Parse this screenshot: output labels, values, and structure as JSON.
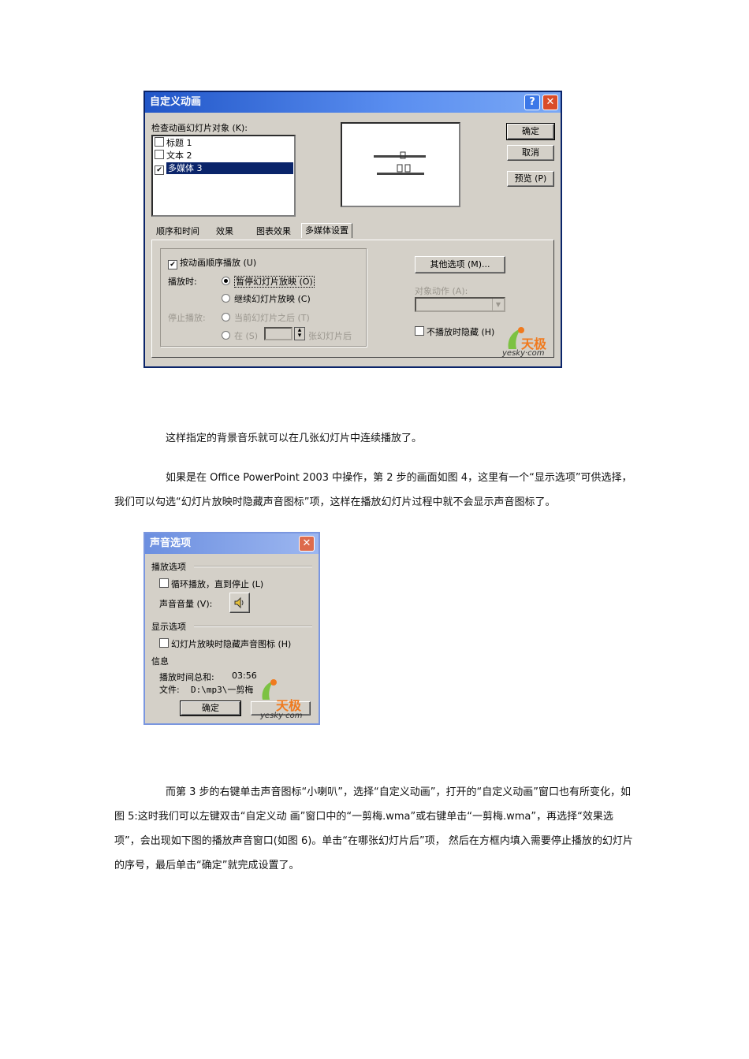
{
  "dialog1": {
    "title": "自定义动画",
    "help_button": "?",
    "close_button": "✕",
    "check_label": "检查动画幻灯片对象 (K):",
    "list_items": [
      {
        "label": "标题 1",
        "checked": false
      },
      {
        "label": "文本 2",
        "checked": false
      },
      {
        "label": "多媒体 3",
        "checked": true
      }
    ],
    "buttons": {
      "ok": "确定",
      "cancel": "取消",
      "preview": "预览 (P)"
    },
    "tabs": [
      "顺序和时间",
      "效果",
      "图表效果",
      "多媒体设置"
    ],
    "play_in_order": "按动画顺序播放 (U)",
    "while_playing_label": "播放时:",
    "pause_slideshow": "暂停幻灯片放映 (O)",
    "continue_slideshow": "继续幻灯片放映 (C)",
    "stop_playing_label": "停止播放:",
    "after_current": "当前幻灯片之后 (T)",
    "after_prefix": "在 (S)",
    "after_suffix": "张幻灯片后",
    "more_options": "其他选项 (M)...",
    "object_action": "对象动作 (A):",
    "hide_when_not_playing": "不播放时隐藏 (H)"
  },
  "watermark": {
    "cn": "天极",
    "en": "yesky·com"
  },
  "paragraphs": {
    "p1": "这样指定的背景音乐就可以在几张幻灯片中连续播放了。",
    "p2": "如果是在 Office PowerPoint 2003 中操作，第 2 步的画面如图 4，这里有一个“显示选项”可供选择，我们可以勾选“幻灯片放映时隐藏声音图标”项，这样在播放幻灯片过程中就不会显示声音图标了。",
    "p3": "而第 3 步的右键单击声音图标“小喇叭”，选择“自定义动画”，打开的“自定义动画”窗口也有所变化，如图 5:这时我们可以左键双击“自定义动 画”窗口中的“一剪梅.wma”或右键单击“一剪梅.wma”，再选择“效果选项”，会出现如下图的播放声音窗口(如图 6)。单击“在哪张幻灯片后”项， 然后在方框内填入需要停止播放的幻灯片的序号，最后单击“确定”就完成设置了。"
  },
  "dialog2": {
    "title": "声音选项",
    "close_button": "✕",
    "play_options": "播放选项",
    "loop": "循环播放，直到停止 (L)",
    "volume": "声音音量 (V):",
    "display_options": "显示选项",
    "hide_icon": "幻灯片放映时隐藏声音图标 (H)",
    "info": "信息",
    "total_time_label": "播放时间总和:",
    "total_time": "03:56",
    "file_label": "文件:",
    "file_path": "D:\\mp3\\一剪梅",
    "ok": "确定"
  }
}
